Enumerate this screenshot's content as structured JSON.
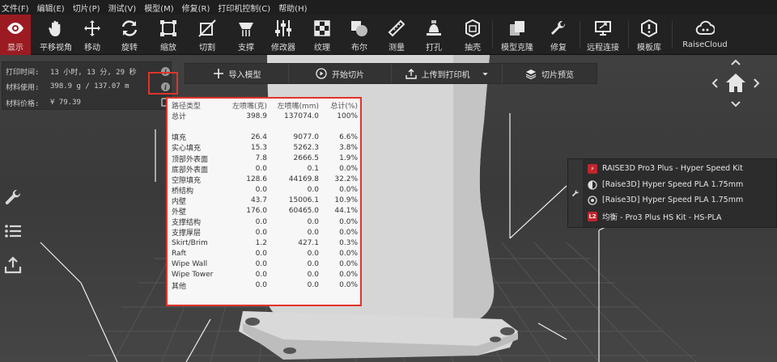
{
  "menu": [
    "文件(F)",
    "编辑(E)",
    "切片(P)",
    "测试(V)",
    "模型(M)",
    "修复(R)",
    "打印机控制(C)",
    "帮助(H)"
  ],
  "toolbar": {
    "display": "显示",
    "pan": "平移视角",
    "move": "移动",
    "rotate": "旋转",
    "scale": "缩放",
    "cut": "切割",
    "support": "支撑",
    "modifier": "修改器",
    "texture": "纹理",
    "boolean": "布尔",
    "measure": "测量",
    "drill": "打孔",
    "shell": "抽壳",
    "clone": "模型克隆",
    "repair": "修复",
    "remote": "远程连接",
    "library": "模板库",
    "cloud": "RaiseCloud"
  },
  "info": {
    "time_label": "打印时间:",
    "time_value": "13 小时, 13 分, 29 秒",
    "material_label": "材料使用:",
    "material_value": "398.9 g / 137.07 m",
    "price_label": "材料价格:",
    "price_value": "¥ 79.39"
  },
  "actions": {
    "import": "导入模型",
    "slice": "开始切片",
    "upload": "上传到打印机",
    "preview": "切片预览"
  },
  "stats": {
    "headers": [
      "路径类型",
      "左喷嘴(克)",
      "左喷嘴(mm)",
      "总计(%)"
    ],
    "total": [
      "总计",
      "398.9",
      "137074.0",
      "100%"
    ],
    "rows": [
      [
        "填充",
        "26.4",
        "9077.0",
        "6.6%"
      ],
      [
        "实心填充",
        "15.3",
        "5262.3",
        "3.8%"
      ],
      [
        "顶部外表面",
        "7.8",
        "2666.5",
        "1.9%"
      ],
      [
        "底部外表面",
        "0.0",
        "0.1",
        "0.0%"
      ],
      [
        "空隙填充",
        "128.6",
        "44169.8",
        "32.2%"
      ],
      [
        "桥结构",
        "0.0",
        "0.0",
        "0.0%"
      ],
      [
        "内壁",
        "43.7",
        "15006.1",
        "10.9%"
      ],
      [
        "外壁",
        "176.0",
        "60465.0",
        "44.1%"
      ],
      [
        "支撑结构",
        "0.0",
        "0.0",
        "0.0%"
      ],
      [
        "支撑厚层",
        "0.0",
        "0.0",
        "0.0%"
      ],
      [
        "Skirt/Brim",
        "1.2",
        "427.1",
        "0.3%"
      ],
      [
        "Raft",
        "0.0",
        "0.0",
        "0.0%"
      ],
      [
        "Wipe Wall",
        "0.0",
        "0.0",
        "0.0%"
      ],
      [
        "Wipe Tower",
        "0.0",
        "0.0",
        "0.0%"
      ],
      [
        "其他",
        "0.0",
        "0.0",
        "0.0%"
      ]
    ]
  },
  "printer": {
    "machine": "RAISE3D Pro3 Plus - Hyper Speed Kit",
    "left_filament": "[Raise3D] Hyper Speed PLA 1.75mm",
    "right_filament": "[Raise3D] Hyper Speed PLA 1.75mm",
    "profile_badge": "L2",
    "profile": "均衡 - Pro3 Plus HS Kit - HS-PLA"
  },
  "colors": {
    "accent": "#9c1b22",
    "highlight": "#e1332a",
    "badge": "#c0262d"
  }
}
